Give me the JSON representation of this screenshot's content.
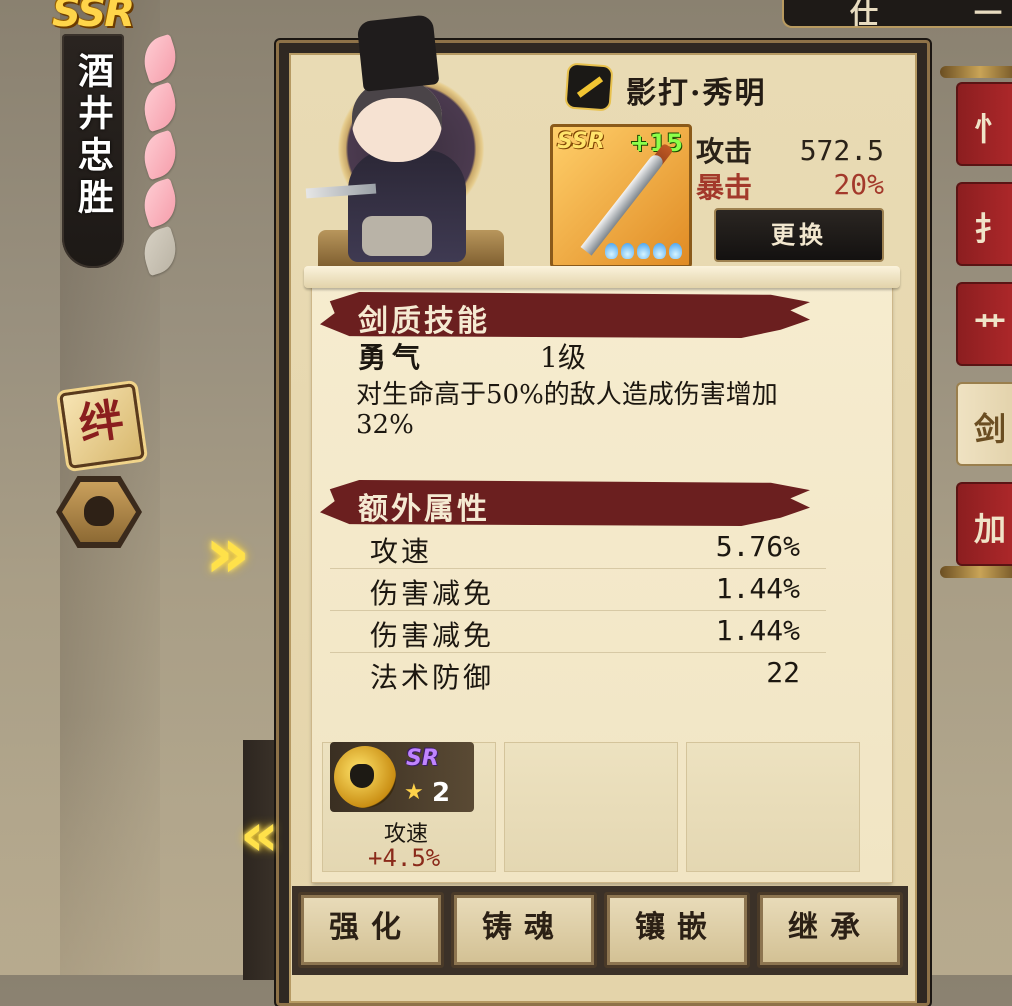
{
  "character": {
    "rarity": "SSR",
    "name": "酒井忠胜",
    "bond_label": "绊",
    "petals_total": 5,
    "petals_filled": 4
  },
  "top_tabs": [
    "仕",
    "一"
  ],
  "right_tabs": [
    "忄",
    "扌",
    "艹",
    "剑",
    "加"
  ],
  "weapon": {
    "name": "影打·秀明",
    "rarity": "SSR",
    "enhance": "+15",
    "stats": [
      {
        "label": "攻击",
        "value": "572.5",
        "color": "#2a2218"
      },
      {
        "label": "暴击",
        "value": "20%",
        "color": "#a3392b"
      }
    ],
    "change_button": "更换"
  },
  "skill_section": {
    "title": "剑质技能",
    "skill_name": "勇气",
    "skill_level": "1级",
    "description": "对生命高于50%的敌人造成伤害增加32%"
  },
  "extra_section": {
    "title": "额外属性",
    "attributes": [
      {
        "name": "攻速",
        "value": "5.76%"
      },
      {
        "name": "伤害减免",
        "value": "1.44%"
      },
      {
        "name": "伤害减免",
        "value": "1.44%"
      },
      {
        "name": "法术防御",
        "value": "22"
      }
    ]
  },
  "gem": {
    "rarity": "SR",
    "stars": "2",
    "stat_name": "攻速",
    "stat_value": "+4.5%"
  },
  "actions": [
    "强化",
    "铸魂",
    "镶嵌",
    "继承"
  ],
  "colors": {
    "brush_red": "#6b1f1f",
    "tab_red": "#b52a2c",
    "gold": "#ffd54a",
    "crit_red": "#a3392b"
  }
}
